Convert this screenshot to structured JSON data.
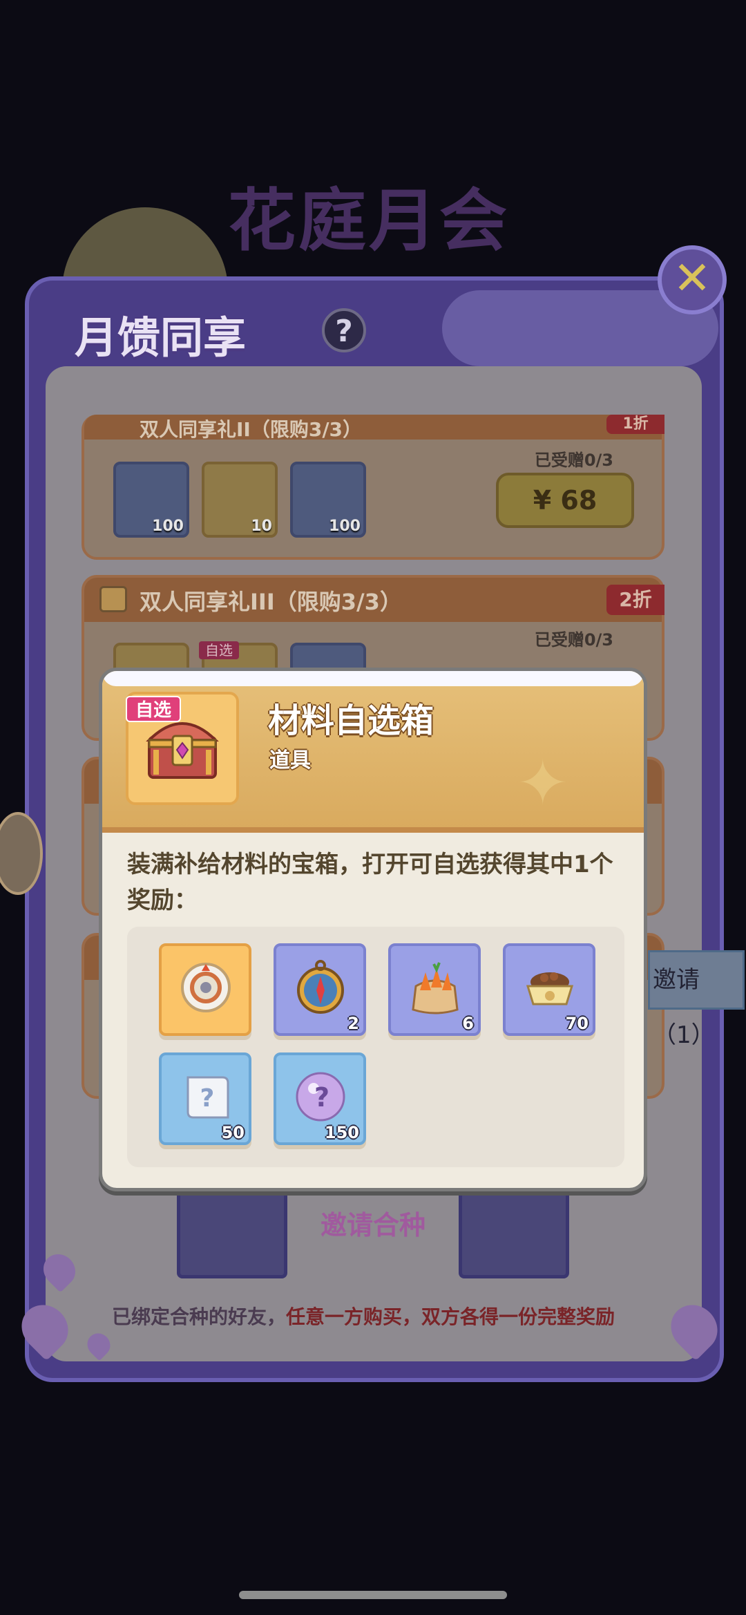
{
  "event": {
    "title": "花庭月会"
  },
  "panel": {
    "title": "月馈同享",
    "help_icon_text": "?",
    "close_icon_text": "✕"
  },
  "packs": [
    {
      "title": "双人同享礼II（限购3/3）",
      "discount": "1折",
      "gifted": "已受赠0/3",
      "price": "¥ 68",
      "items": [
        {
          "icon": "recipe-book-icon",
          "qty": "100",
          "style": "blue"
        },
        {
          "icon": "golden-flower-badge-icon",
          "qty": "10",
          "style": "gold"
        },
        {
          "icon": "meat-drumstick-icon",
          "qty": "100",
          "style": "blue"
        }
      ]
    },
    {
      "title": "双人同享礼III（限购3/3）",
      "discount": "2折",
      "gifted": "已受赠0/3",
      "tag": "自选"
    }
  ],
  "side_tab": {
    "label": "邀请（1）"
  },
  "invite": {
    "label": "邀请合种"
  },
  "binding_note": {
    "part1": "已绑定合种的好友，",
    "part2": "任意一方购买，双方各得一份完整奖励"
  },
  "popup": {
    "tag": "自选",
    "name": "材料自选箱",
    "type": "道具",
    "description": "装满补给材料的宝箱，打开可自选获得其中1个奖励：",
    "rewards": [
      {
        "icon": "gear-token-icon",
        "qty": "",
        "style": "gold"
      },
      {
        "icon": "compass-icon",
        "qty": "2",
        "style": "purple"
      },
      {
        "icon": "carrot-sack-icon",
        "qty": "6",
        "style": "purple"
      },
      {
        "icon": "pet-food-bowl-icon",
        "qty": "70",
        "style": "purple"
      },
      {
        "icon": "mystery-scroll-icon",
        "qty": "50",
        "style": "blue"
      },
      {
        "icon": "mystery-orb-icon",
        "qty": "150",
        "style": "blue"
      }
    ]
  }
}
